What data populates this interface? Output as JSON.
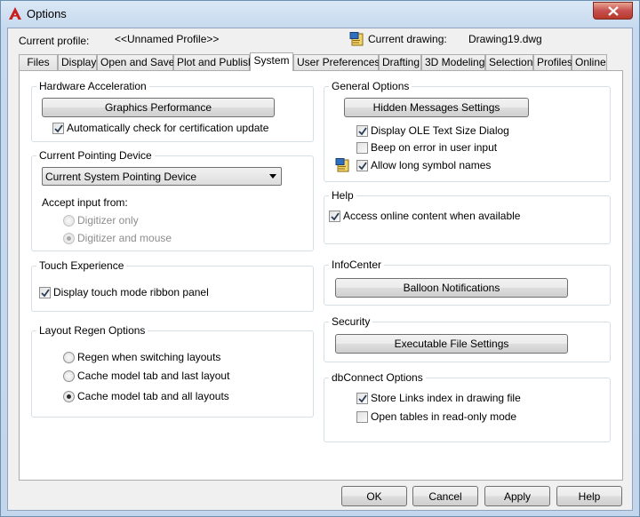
{
  "window": {
    "title": "Options"
  },
  "header": {
    "profile_label": "Current profile:",
    "profile_value": "<<Unnamed Profile>>",
    "drawing_label": "Current drawing:",
    "drawing_value": "Drawing19.dwg",
    "drawing_icon": "drawing-file-icon"
  },
  "tabs": [
    "Files",
    "Display",
    "Open and Save",
    "Plot and Publish",
    "System",
    "User Preferences",
    "Drafting",
    "3D Modeling",
    "Selection",
    "Profiles",
    "Online"
  ],
  "active_tab": "System",
  "hardware": {
    "title": "Hardware Acceleration",
    "button": "Graphics Performance",
    "check_label": "Automatically check for certification update",
    "check_value": true
  },
  "pointing": {
    "title": "Current Pointing Device",
    "selected": "Current System Pointing Device",
    "accept_label": "Accept input from:",
    "options": [
      "Digitizer only",
      "Digitizer and mouse"
    ],
    "selected_option": "Digitizer and mouse",
    "disabled": true
  },
  "touch": {
    "title": "Touch Experience",
    "check_label": "Display touch mode ribbon panel",
    "check_value": true
  },
  "regen": {
    "title": "Layout Regen Options",
    "options": [
      "Regen when switching layouts",
      "Cache model tab and last layout",
      "Cache model tab and all layouts"
    ],
    "selected": "Cache model tab and all layouts"
  },
  "general": {
    "title": "General Options",
    "button": "Hidden Messages Settings",
    "checks": [
      {
        "label": "Display OLE Text Size Dialog",
        "value": true
      },
      {
        "label": "Beep on error in user input",
        "value": false
      },
      {
        "label": "Allow long symbol names",
        "value": true
      }
    ],
    "symbol_icon": "drawing-file-icon"
  },
  "help": {
    "title": "Help",
    "check_label": "Access online content when available",
    "check_value": true
  },
  "infocenter": {
    "title": "InfoCenter",
    "button": "Balloon Notifications"
  },
  "security": {
    "title": "Security",
    "button": "Executable File Settings"
  },
  "dbconnect": {
    "title": "dbConnect Options",
    "checks": [
      {
        "label": "Store Links index in drawing file",
        "value": true
      },
      {
        "label": "Open tables in read-only mode",
        "value": false
      }
    ]
  },
  "footer": {
    "ok": "OK",
    "cancel": "Cancel",
    "apply": "Apply",
    "help": "Help"
  },
  "colors": {
    "accent": "#2c6fb8",
    "close_button": "#c75050",
    "app_icon": "#c8201e"
  }
}
